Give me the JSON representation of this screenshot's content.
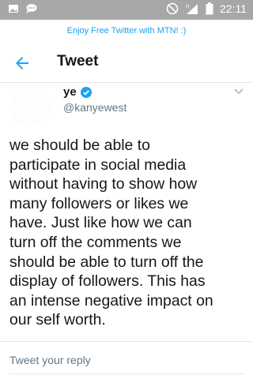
{
  "statusbar": {
    "time": "22:11",
    "icons": [
      "image-icon",
      "chat-bubble-icon",
      "do-not-disturb-icon",
      "signal-icon",
      "battery-icon"
    ]
  },
  "banner": {
    "text": "Enjoy Free Twitter with MTN! :)"
  },
  "appbar": {
    "title": "Tweet",
    "back_icon": "back-arrow-icon"
  },
  "tweet": {
    "author_name": "ye",
    "handle": "@kanyewest",
    "verified": true,
    "text": "we should be able to\nparticipate in social media\nwithout having to show how\nmany followers or likes we\nhave. Just like how we can\nturn off the comments we\nshould be able to turn off the\ndisplay of followers. This has\nan intense negative impact on\nour self worth."
  },
  "reply": {
    "placeholder": "Tweet your reply"
  },
  "colors": {
    "accent": "#1da1f2",
    "status_bar": "#a7a7a7",
    "text": "#14171a",
    "muted": "#657786"
  }
}
